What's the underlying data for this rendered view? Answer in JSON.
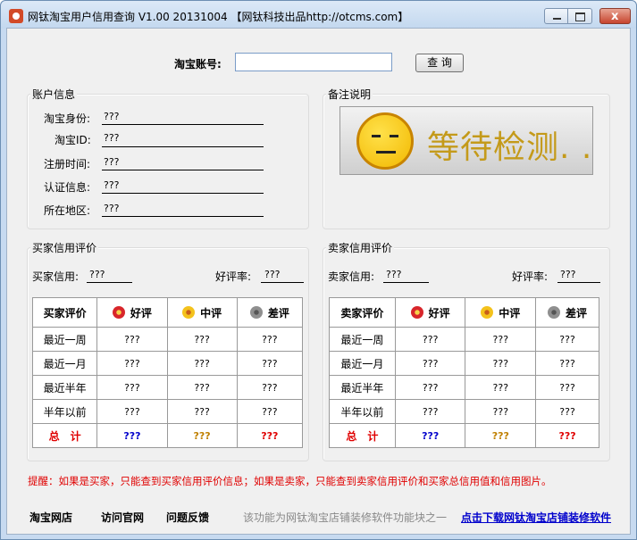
{
  "window": {
    "title": "网钛淘宝用户信用查询 V1.00 20131004 【网钛科技出品http://otcms.com】",
    "close_glyph": "x"
  },
  "search": {
    "label": "淘宝账号:",
    "value": "",
    "button": "查 询"
  },
  "account": {
    "title": "账户信息",
    "fields": [
      {
        "label": "淘宝身份:",
        "value": "???"
      },
      {
        "label": "淘宝ID:",
        "value": "???"
      },
      {
        "label": "注册时间:",
        "value": "???"
      },
      {
        "label": "认证信息:",
        "value": "???"
      },
      {
        "label": "所在地区:",
        "value": "???"
      }
    ]
  },
  "notes": {
    "title": "备注说明",
    "status_text": "等待检测. ."
  },
  "buyer": {
    "title": "买家信用评价",
    "credit_label": "买家信用:",
    "credit_value": "???",
    "rate_label": "好评率:",
    "rate_value": "???",
    "headers": [
      "买家评价",
      "好评",
      "中评",
      "差评"
    ],
    "rows": [
      {
        "period": "最近一周",
        "good": "???",
        "neutral": "???",
        "bad": "???"
      },
      {
        "period": "最近一月",
        "good": "???",
        "neutral": "???",
        "bad": "???"
      },
      {
        "period": "最近半年",
        "good": "???",
        "neutral": "???",
        "bad": "???"
      },
      {
        "period": "半年以前",
        "good": "???",
        "neutral": "???",
        "bad": "???"
      }
    ],
    "total": {
      "label": "总　计",
      "good": "???",
      "neutral": "???",
      "bad": "???"
    }
  },
  "seller": {
    "title": "卖家信用评价",
    "credit_label": "卖家信用:",
    "credit_value": "???",
    "rate_label": "好评率:",
    "rate_value": "???",
    "headers": [
      "卖家评价",
      "好评",
      "中评",
      "差评"
    ],
    "rows": [
      {
        "period": "最近一周",
        "good": "???",
        "neutral": "???",
        "bad": "???"
      },
      {
        "period": "最近一月",
        "good": "???",
        "neutral": "???",
        "bad": "???"
      },
      {
        "period": "最近半年",
        "good": "???",
        "neutral": "???",
        "bad": "???"
      },
      {
        "period": "半年以前",
        "good": "???",
        "neutral": "???",
        "bad": "???"
      }
    ],
    "total": {
      "label": "总　计",
      "good": "???",
      "neutral": "???",
      "bad": "???"
    }
  },
  "tip": "提醒：如果是买家，只能查到买家信用评价信息；如果是卖家，只能查到卖家信用评价和买家总信用值和信用图片。",
  "footer": {
    "links": [
      "淘宝网店",
      "访问官网",
      "问题反馈"
    ],
    "note": "该功能为网钛淘宝店铺装修软件功能块之一",
    "download": "点击下载网钛淘宝店铺装修软件"
  },
  "colors": {
    "tip": "#e00000",
    "total_good": "#0000cc",
    "total_neutral": "#c08000",
    "total_bad": "#e00000",
    "download_link": "#0000cc",
    "status_text": "#c49a1a"
  }
}
